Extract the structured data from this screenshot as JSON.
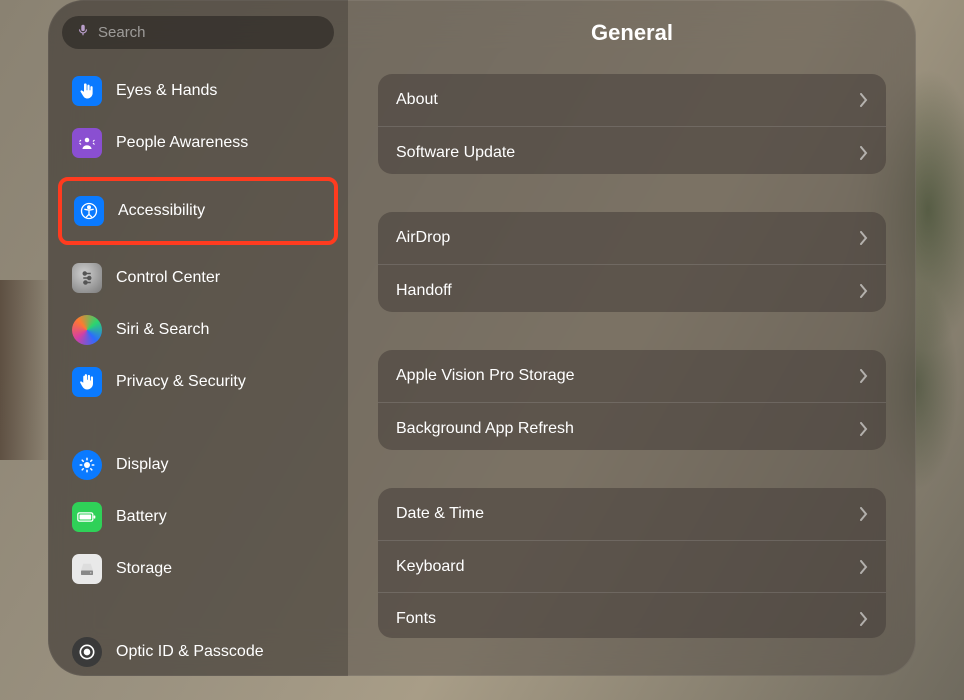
{
  "search": {
    "placeholder": "Search"
  },
  "sidebar": {
    "items": [
      {
        "label": "Eyes & Hands"
      },
      {
        "label": "People Awareness"
      },
      {
        "label": "Accessibility"
      },
      {
        "label": "Control Center"
      },
      {
        "label": "Siri & Search"
      },
      {
        "label": "Privacy & Security"
      },
      {
        "label": "Display"
      },
      {
        "label": "Battery"
      },
      {
        "label": "Storage"
      },
      {
        "label": "Optic ID & Passcode"
      }
    ]
  },
  "main": {
    "title": "General",
    "groups": [
      [
        {
          "label": "About"
        },
        {
          "label": "Software Update"
        }
      ],
      [
        {
          "label": "AirDrop"
        },
        {
          "label": "Handoff"
        }
      ],
      [
        {
          "label": "Apple Vision Pro Storage"
        },
        {
          "label": "Background App Refresh"
        }
      ],
      [
        {
          "label": "Date & Time"
        },
        {
          "label": "Keyboard"
        },
        {
          "label": "Fonts"
        }
      ]
    ]
  }
}
